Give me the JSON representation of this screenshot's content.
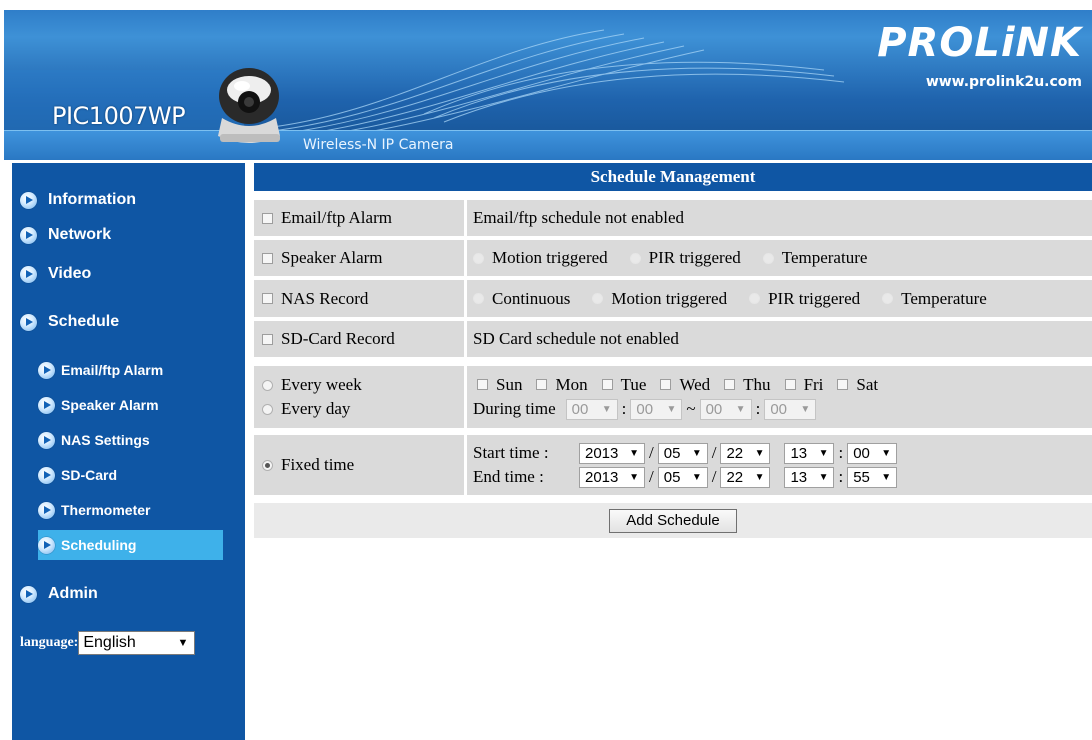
{
  "header": {
    "model": "PIC1007WP",
    "product_type": "Wireless-N IP Camera",
    "brand": "PROLiNK",
    "brand_url": "www.prolink2u.com"
  },
  "sidebar": {
    "nav": {
      "information": "Information",
      "network": "Network",
      "video": "Video",
      "schedule": "Schedule",
      "admin": "Admin"
    },
    "schedule_items": [
      {
        "label": "Email/ftp Alarm",
        "active": false
      },
      {
        "label": "Speaker Alarm",
        "active": false
      },
      {
        "label": "NAS Settings",
        "active": false
      },
      {
        "label": "SD-Card",
        "active": false
      },
      {
        "label": "Thermometer",
        "active": false
      },
      {
        "label": "Scheduling",
        "active": true
      }
    ],
    "language_label": "language:",
    "language_value": "English"
  },
  "main": {
    "title": "Schedule Management",
    "email": {
      "label": "Email/ftp Alarm",
      "status": "Email/ftp schedule not enabled"
    },
    "speaker": {
      "label": "Speaker Alarm",
      "options": [
        "Motion triggered",
        "PIR triggered",
        "Temperature"
      ]
    },
    "nas": {
      "label": "NAS Record",
      "options": [
        "Continuous",
        "Motion triggered",
        "PIR triggered",
        "Temperature"
      ]
    },
    "sdcard": {
      "label": "SD-Card Record",
      "status": "SD Card schedule not enabled"
    },
    "recurrence": {
      "every_week": "Every week",
      "every_day": "Every day",
      "days": [
        "Sun",
        "Mon",
        "Tue",
        "Wed",
        "Thu",
        "Fri",
        "Sat"
      ],
      "during_time_label": "During time",
      "from_hour": "00",
      "from_min": "00",
      "to_hour": "00",
      "to_min": "00",
      "tilde": "~"
    },
    "fixed": {
      "label": "Fixed time",
      "start_label": "Start time :",
      "end_label": "End time :",
      "start": {
        "year": "2013",
        "month": "05",
        "day": "22",
        "hour": "13",
        "minute": "00"
      },
      "end": {
        "year": "2013",
        "month": "05",
        "day": "22",
        "hour": "13",
        "minute": "55"
      }
    },
    "add_button": "Add Schedule"
  }
}
